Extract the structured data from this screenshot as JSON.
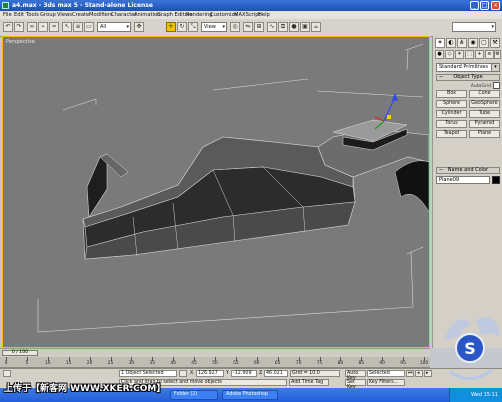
{
  "window": {
    "title": "a4.max - 3ds max 5 - Stand-alone License",
    "controls": [
      "_",
      "□",
      "×"
    ]
  },
  "menu": [
    "File",
    "Edit",
    "Tools",
    "Group",
    "Views",
    "Create",
    "Modifiers",
    "Character",
    "Animation",
    "Graph Editors",
    "Rendering",
    "Customize",
    "MAXScript",
    "Help"
  ],
  "toolbar": {
    "filter_value": "All",
    "refcoord_value": "View"
  },
  "viewport": {
    "label": "Perspective"
  },
  "command_panel": {
    "category_dropdown": "Standard Primitives",
    "object_type_title": "Object Type",
    "autogrid_label": "AutoGrid",
    "objects": [
      "Box",
      "Cone",
      "Sphere",
      "GeoSphere",
      "Cylinder",
      "Tube",
      "Torus",
      "Pyramid",
      "Teapot",
      "Plane"
    ],
    "name_color_title": "Name and Color",
    "object_name": "Plane09",
    "object_color": "#000000"
  },
  "timeline": {
    "slider_label": "0 / 100",
    "ticks": [
      "0",
      "5",
      "10",
      "15",
      "20",
      "25",
      "30",
      "35",
      "40",
      "45",
      "50",
      "55",
      "60",
      "65",
      "70",
      "75",
      "80",
      "85",
      "90",
      "95",
      "100"
    ]
  },
  "status": {
    "selection": "1 Object Selected",
    "prompt": "Click and drag to select and move objects",
    "x_label": "X",
    "x_value": "126.927",
    "y_label": "Y",
    "y_value": "-12.909",
    "z_label": "Z",
    "z_value": "46.021",
    "grid": "Grid = 10.0",
    "add_time_tag": "Add Time Tag",
    "auto_key": "Auto Key",
    "set_key": "Set Key",
    "selected_dropdown": "Selected",
    "key_filters": "Key Filters..."
  },
  "taskbar": {
    "items": [
      "Folder (2)",
      "Adobe Photoshop"
    ],
    "clock": "Wed 15:11"
  },
  "overlay": {
    "banner": "上传于【新客网 WWW.XKER.COM】"
  }
}
